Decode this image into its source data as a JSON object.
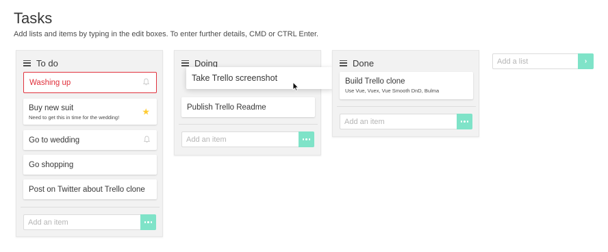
{
  "page": {
    "title": "Tasks",
    "subtitle": "Add lists and items by typing in the edit boxes. To enter further details, CMD or CTRL Enter."
  },
  "lists": [
    {
      "title": "To do",
      "cards": [
        {
          "title": "Washing up",
          "description": "",
          "icon": "bell-icon",
          "state": "danger"
        },
        {
          "title": "Buy new suit",
          "description": "Need to get this in time for the wedding!",
          "icon": "star-icon",
          "state": "normal"
        },
        {
          "title": "Go to wedding",
          "description": "",
          "icon": "bell-icon",
          "state": "normal"
        },
        {
          "title": "Go shopping",
          "description": "",
          "icon": "",
          "state": "normal"
        },
        {
          "title": "Post on Twitter about Trello clone",
          "description": "",
          "icon": "",
          "state": "normal"
        }
      ],
      "add_placeholder": "Add an item"
    },
    {
      "title": "Doing",
      "cards": [
        {
          "title": "Take Trello screenshot",
          "description": "",
          "icon": "",
          "state": "dragging"
        },
        {
          "title": "Publish Trello Readme",
          "description": "",
          "icon": "",
          "state": "normal"
        }
      ],
      "add_placeholder": "Add an item"
    },
    {
      "title": "Done",
      "cards": [
        {
          "title": "Build Trello clone",
          "description": "Use Vue, Vuex, Vue Smooth DnD, Bulma",
          "icon": "",
          "state": "normal"
        }
      ],
      "add_placeholder": "Add an item"
    }
  ],
  "add_list": {
    "placeholder": "Add a list"
  },
  "colors": {
    "accent": "#7fe3c8",
    "danger": "#e0303b",
    "star": "#ffcc33",
    "list_bg": "#f2f2f2"
  }
}
